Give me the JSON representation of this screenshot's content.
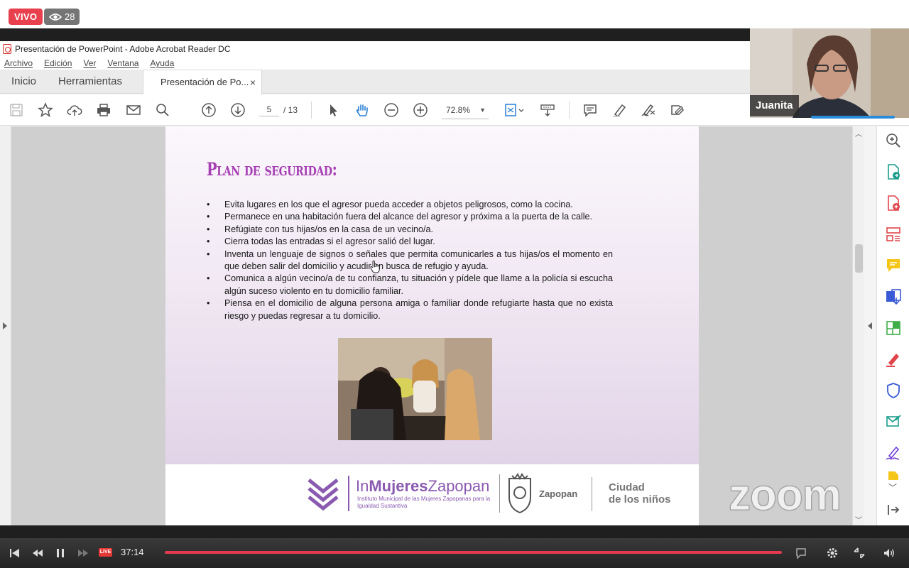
{
  "stream": {
    "live_label": "VIVO",
    "viewer_count": "28"
  },
  "window": {
    "title": "Presentación de PowerPoint - Adobe Acrobat Reader DC"
  },
  "menu": [
    "Archivo",
    "Edición",
    "Ver",
    "Ventana",
    "Ayuda"
  ],
  "tabs": {
    "home": "Inicio",
    "tools": "Herramientas",
    "document": "Presentación de Po...",
    "close": "×"
  },
  "toolbar": {
    "current_page": "5",
    "total_pages": "/ 13",
    "zoom": "72.8%"
  },
  "slide": {
    "title": "Plan de seguridad:",
    "bullets": [
      "Evita lugares en los que el agresor pueda acceder a objetos peligrosos, como la cocina.",
      "Permanece en una habitación fuera del alcance del agresor y próxima a la puerta de la calle.",
      "Refúgiate con tus hijas/os en la casa de un vecino/a.",
      "Cierra todas las entradas si el agresor salió del lugar.",
      "Inventa un lenguaje de signos o señales que permita comunicarles a tus hijas/os el momento en que deben salir del domicilio y acudir en busca de refugio y ayuda.",
      "Comunica a algún vecino/a de tu confianza, tu situación y pídele que llame a la policía si escucha algún suceso violento en tu domicilio familiar.",
      "Piensa en el domicilio de alguna persona amiga o familiar donde refugiarte hasta que no exista riesgo y puedas regresar a tu domicilio."
    ],
    "logo_prefix": "In",
    "logo_bold": "Mujeres",
    "logo_suffix": "Zapopan",
    "logo_subtitle": "Instituto Municipal de las Mujeres Zapopanas para la Igualdad Sustantiva",
    "municipality": "Zapopan",
    "ciudad_line1": "Ciudad",
    "ciudad_line2": "de los niños"
  },
  "participant": {
    "name": "Juanita"
  },
  "watermark": "zoom",
  "player": {
    "live_badge": "LIVE",
    "time": "37:14",
    "progress": 1.0
  },
  "colors": {
    "accent_purple": "#a63fb4",
    "live_red": "#e8404d",
    "progress_red": "#e53950",
    "speaker_blue": "#2a8bd8"
  }
}
